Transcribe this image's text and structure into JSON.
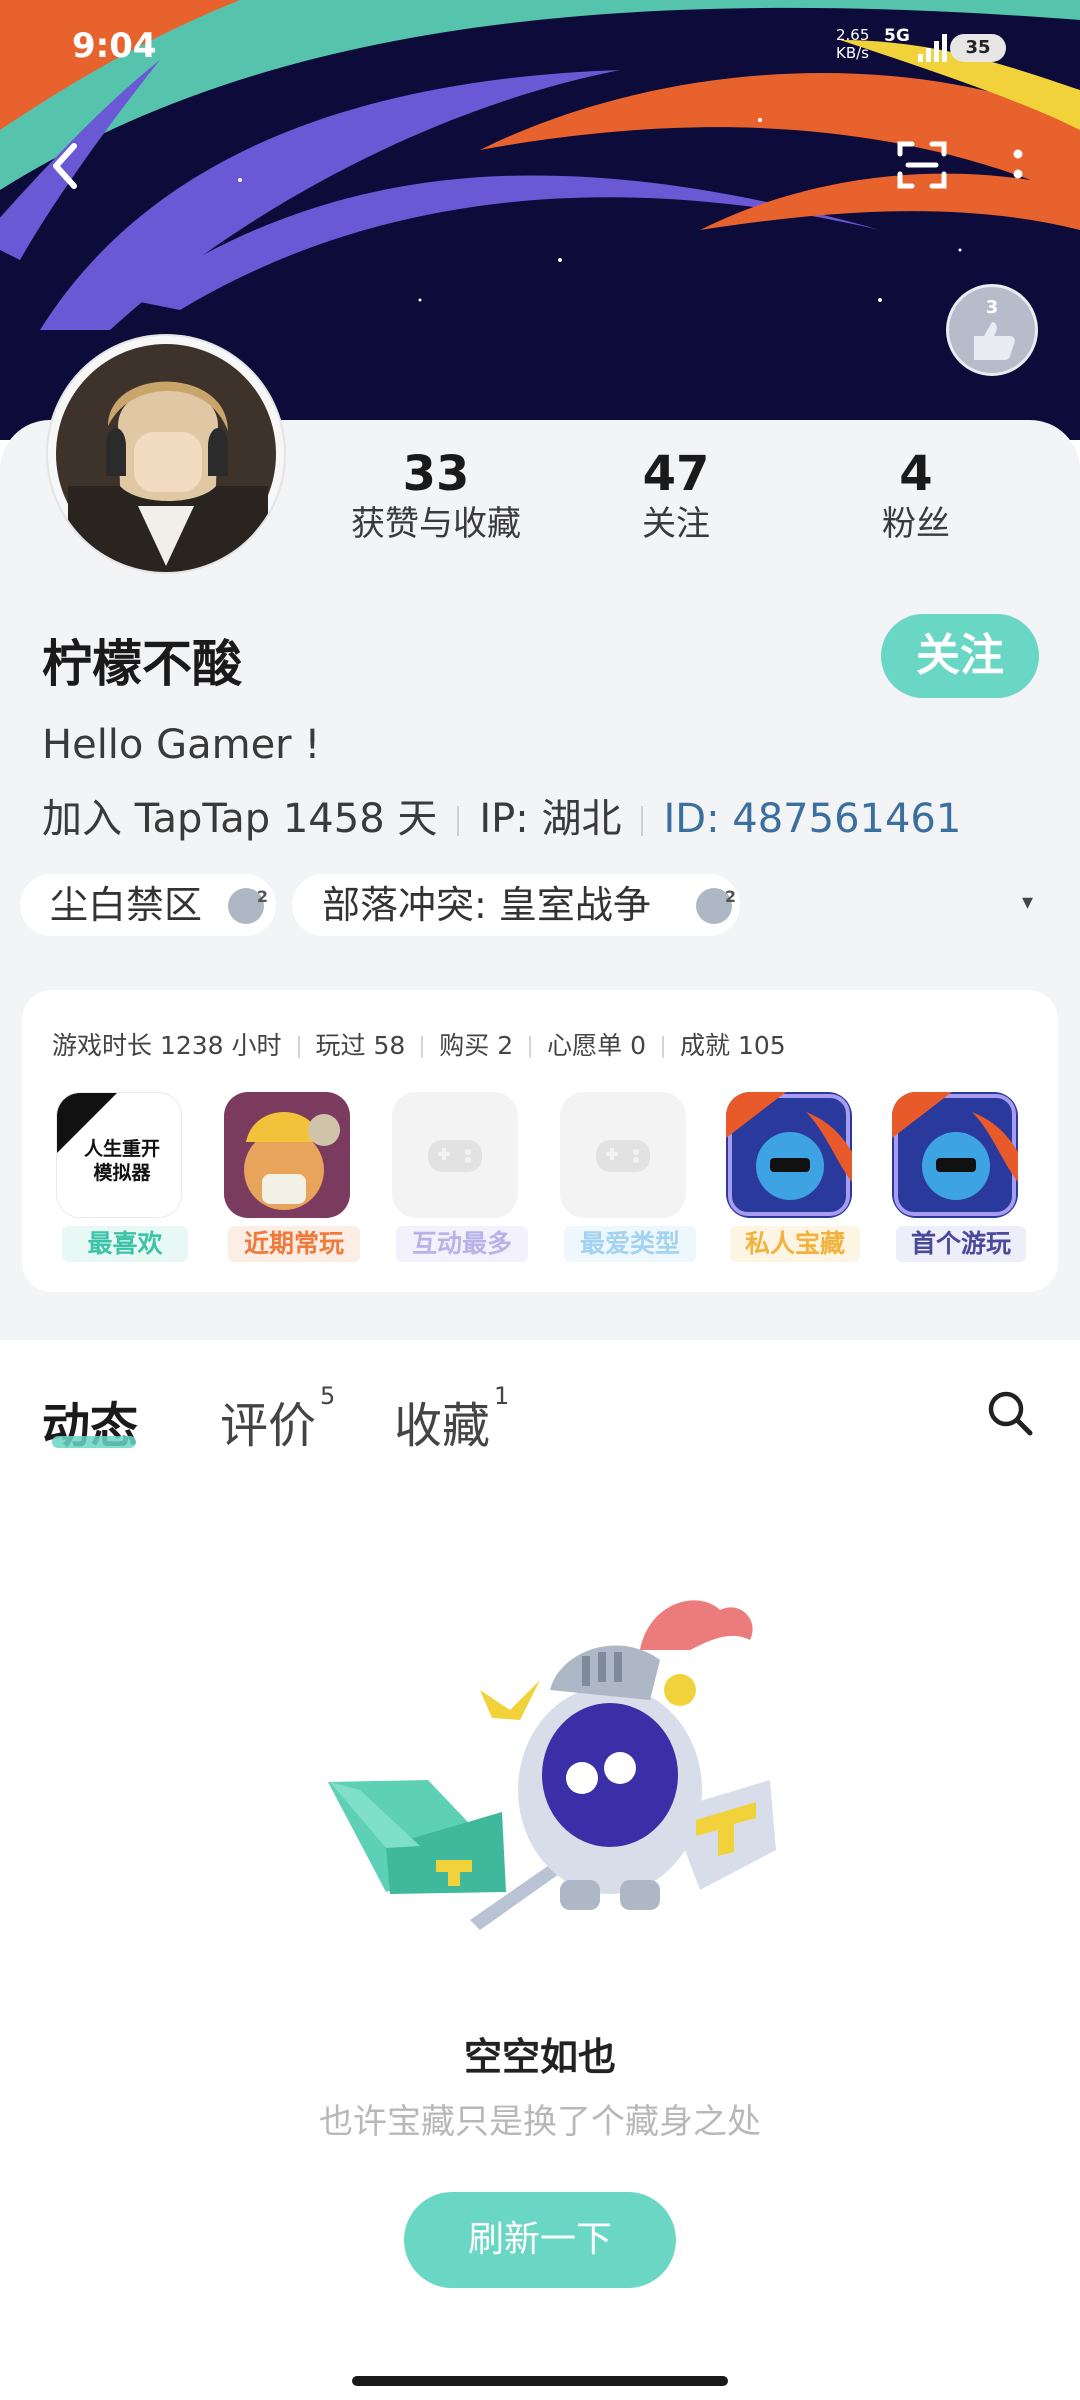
{
  "status": {
    "time": "9:04",
    "speed": "2.65",
    "speed_unit": "KB/s",
    "network": "5G",
    "battery": "35"
  },
  "header": {
    "back_icon": "back-arrow-icon",
    "scan_icon": "scan-icon",
    "more_icon": "more-icon",
    "medal": {
      "count": "3"
    }
  },
  "profile": {
    "stats": [
      {
        "value": "33",
        "label": "获赞与收藏"
      },
      {
        "value": "47",
        "label": "关注"
      },
      {
        "value": "4",
        "label": "粉丝"
      }
    ],
    "name": "柠檬不酸",
    "follow_label": "关注",
    "bio": "Hello Gamer !",
    "joined": "加入 TapTap 1458 天",
    "ip": "IP: 湖北",
    "id": "ID: 487561461",
    "tags": [
      {
        "label": "尘白禁区",
        "badge": "2"
      },
      {
        "label": "部落冲突: 皇室战争",
        "badge": "2"
      }
    ]
  },
  "game_stats": {
    "items": [
      "游戏时长 1238 小时",
      "玩过 58",
      "购买 2",
      "心愿单 0",
      "成就 105"
    ],
    "cards": [
      {
        "label": "最喜欢",
        "thumb_text": "人生重开\n模拟器",
        "color": "#3cc3a8"
      },
      {
        "label": "近期常玩",
        "color": "#f07a3c"
      },
      {
        "label": "互动最多",
        "color": "#b9b2e8"
      },
      {
        "label": "最爱类型",
        "color": "#a3d3ef"
      },
      {
        "label": "私人宝藏",
        "color": "#f2b23c"
      },
      {
        "label": "首个游玩",
        "color": "#4a4a9c"
      }
    ]
  },
  "tabs": [
    {
      "label": "动态",
      "count": ""
    },
    {
      "label": "评价",
      "count": "5"
    },
    {
      "label": "收藏",
      "count": "1"
    }
  ],
  "empty_state": {
    "title": "空空如也",
    "subtitle": "也许宝藏只是换了个藏身之处",
    "button": "刷新一下"
  },
  "colors": {
    "accent": "#6ad6c4",
    "id_link": "#3b6fa0"
  }
}
